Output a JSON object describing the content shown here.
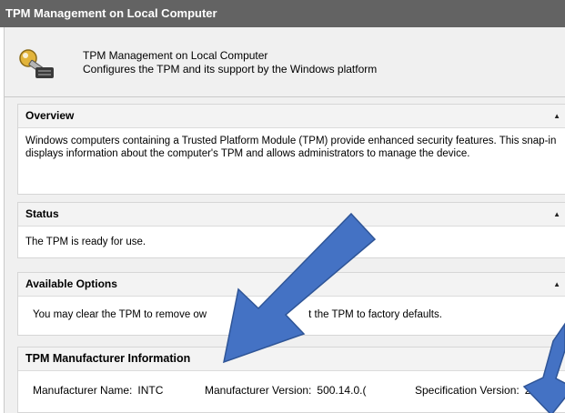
{
  "window": {
    "title": "TPM Management on Local Computer"
  },
  "header": {
    "title": "TPM Management on Local Computer",
    "subtitle": "Configures the TPM and its support by the Windows platform"
  },
  "overview": {
    "heading": "Overview",
    "text": "Windows computers containing a Trusted Platform Module (TPM) provide enhanced security features. This snap-in displays information about the computer's TPM and allows administrators to manage the device."
  },
  "status": {
    "heading": "Status",
    "text": "The TPM is ready for use."
  },
  "options": {
    "heading": "Available Options",
    "text_before": "You may clear the TPM to remove ow",
    "text_after": "t the TPM to factory defaults."
  },
  "manufacturer": {
    "heading": "TPM Manufacturer Information",
    "name_label": "Manufacturer Name:",
    "name_value": "INTC",
    "version_label": "Manufacturer Version:",
    "version_value": "500.14.0.(",
    "spec_label": "Specification Version:",
    "spec_value": "2.0"
  },
  "icons": {
    "header": "key-icon",
    "collapse": "collapse-caret-icon"
  },
  "annotation_color": "#4472c4"
}
